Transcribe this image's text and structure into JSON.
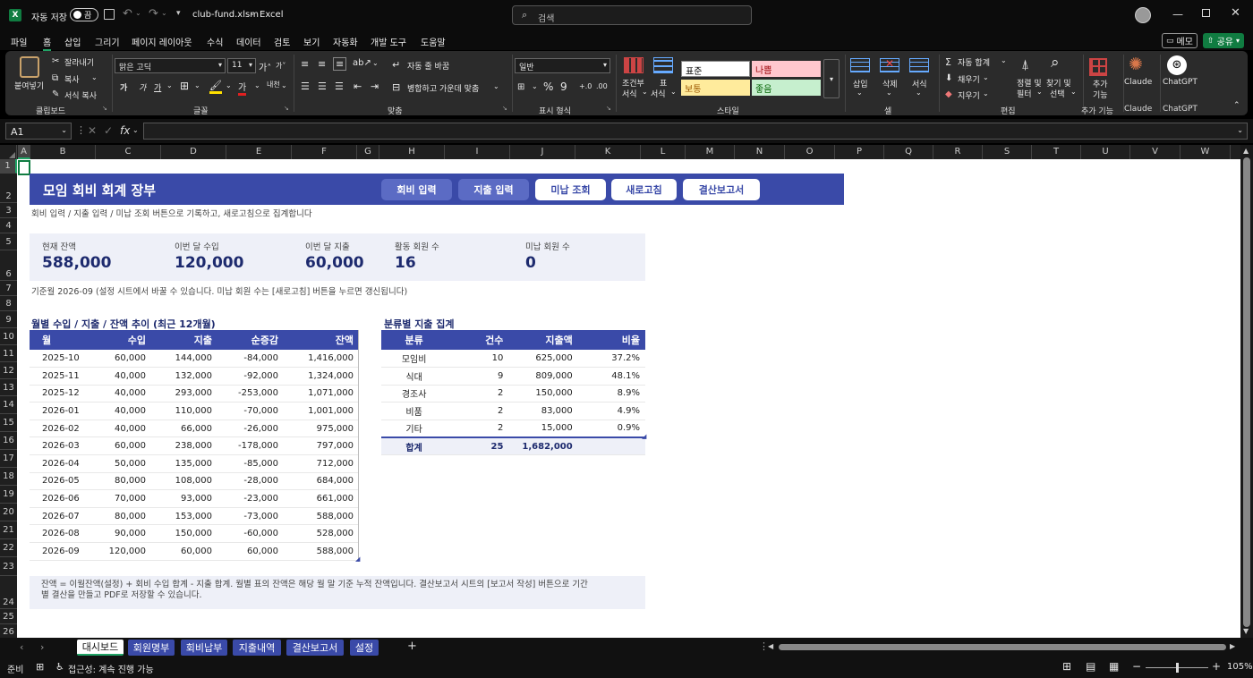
{
  "titlebar": {
    "autosave_label": "자동 저장",
    "autosave_state": "끔",
    "filename": "club-fund.xlsm",
    "app": "Excel",
    "search_placeholder": "검색",
    "separator": "-"
  },
  "menu": [
    "파일",
    "홈",
    "삽입",
    "그리기",
    "페이지 레이아웃",
    "수식",
    "데이터",
    "검토",
    "보기",
    "자동화",
    "개발 도구",
    "도움말"
  ],
  "memo_label": "메모",
  "share_label": "공유",
  "ribbon": {
    "paste": "붙여넣기",
    "cut": "잘라내기",
    "copy": "복사",
    "format_painter": "서식 복사",
    "clipboard": "클립보드",
    "font_name": "맑은 고딕",
    "font_size": "11",
    "font_group": "글꼴",
    "wrap": "자동 줄 바꿈",
    "merge": "병합하고 가운데 맞춤",
    "align_group": "맞춤",
    "number_format": "일반",
    "number_group": "표시 형식",
    "cond_format_1": "조건부",
    "cond_format_2": "서식",
    "table_format_1": "표",
    "table_format_2": "서식",
    "style_normal": "표준",
    "style_bad": "나쁨",
    "style_neutral": "보통",
    "style_good": "좋음",
    "styles_group": "스타일",
    "insert": "삽입",
    "delete": "삭제",
    "format": "서식",
    "cells_group": "셀",
    "autosum": "자동 합계",
    "fill": "채우기",
    "clear": "지우기",
    "sort_1": "정렬 및",
    "sort_2": "필터",
    "find_1": "찾기 및",
    "find_2": "선택",
    "edit_group": "편집",
    "addins_1": "추가",
    "addins_2": "기능",
    "addins_group": "추가 기능",
    "claude": "Claude",
    "chatgpt": "ChatGPT"
  },
  "formula": {
    "cell_ref": "A1",
    "fx": "fx",
    "value": ""
  },
  "columns": [
    "A",
    "B",
    "C",
    "D",
    "E",
    "F",
    "G",
    "H",
    "I",
    "J",
    "K",
    "L",
    "M",
    "N",
    "O",
    "P",
    "Q",
    "R",
    "S",
    "T",
    "U",
    "V",
    "W"
  ],
  "rows": [
    "1",
    "2",
    "3",
    "4",
    "5",
    "6",
    "7",
    "8",
    "9",
    "10",
    "11",
    "12",
    "13",
    "14",
    "15",
    "16",
    "17",
    "18",
    "19",
    "20",
    "21",
    "22",
    "23",
    "24",
    "25",
    "26"
  ],
  "dashboard": {
    "title": "모임 회비 회계 장부",
    "buttons": [
      "회비 입력",
      "지출 입력",
      "미납 조회",
      "새로고침",
      "결산보고서"
    ],
    "subtitle": "회비 입력 / 지출 입력 / 미납 조회 버튼으로 기록하고, 새로고침으로 집계합니다",
    "kpis": [
      {
        "label": "현재 잔액",
        "value": "588,000"
      },
      {
        "label": "이번 달 수입",
        "value": "120,000"
      },
      {
        "label": "이번 달 지출",
        "value": "60,000"
      },
      {
        "label": "활동 회원 수",
        "value": "16"
      },
      {
        "label": "미납 회원 수",
        "value": "0"
      }
    ],
    "base_note": "기준월 2026-09  (설정 시트에서 바꿀 수 있습니다. 미납 회원 수는 [새로고침] 버튼을 누르면 갱신됩니다)",
    "monthly_title": "월별 수입 / 지출 / 잔액 추이 (최근 12개월)",
    "monthly_headers": [
      "월",
      "수입",
      "지출",
      "순증감",
      "잔액"
    ],
    "monthly_rows": [
      [
        "2025-10",
        "60,000",
        "144,000",
        "-84,000",
        "1,416,000"
      ],
      [
        "2025-11",
        "40,000",
        "132,000",
        "-92,000",
        "1,324,000"
      ],
      [
        "2025-12",
        "40,000",
        "293,000",
        "-253,000",
        "1,071,000"
      ],
      [
        "2026-01",
        "40,000",
        "110,000",
        "-70,000",
        "1,001,000"
      ],
      [
        "2026-02",
        "40,000",
        "66,000",
        "-26,000",
        "975,000"
      ],
      [
        "2026-03",
        "60,000",
        "238,000",
        "-178,000",
        "797,000"
      ],
      [
        "2026-04",
        "50,000",
        "135,000",
        "-85,000",
        "712,000"
      ],
      [
        "2026-05",
        "80,000",
        "108,000",
        "-28,000",
        "684,000"
      ],
      [
        "2026-06",
        "70,000",
        "93,000",
        "-23,000",
        "661,000"
      ],
      [
        "2026-07",
        "80,000",
        "153,000",
        "-73,000",
        "588,000"
      ],
      [
        "2026-08",
        "90,000",
        "150,000",
        "-60,000",
        "528,000"
      ],
      [
        "2026-09",
        "120,000",
        "60,000",
        "60,000",
        "588,000"
      ]
    ],
    "category_title": "분류별 지출 집계",
    "category_headers": [
      "분류",
      "건수",
      "지출액",
      "비율"
    ],
    "category_rows": [
      [
        "모임비",
        "10",
        "625,000",
        "37.2%"
      ],
      [
        "식대",
        "9",
        "809,000",
        "48.1%"
      ],
      [
        "경조사",
        "2",
        "150,000",
        "8.9%"
      ],
      [
        "비품",
        "2",
        "83,000",
        "4.9%"
      ],
      [
        "기타",
        "2",
        "15,000",
        "0.9%"
      ]
    ],
    "category_total": [
      "합계",
      "25",
      "1,682,000",
      ""
    ],
    "footer_note_1": "잔액 = 이월잔액(설정) + 회비 수입 합계 - 지출 합계.  월별 표의 잔액은 해당 월 말 기준 누적 잔액입니다. 결산보고서 시트의 [보고서 작성] 버튼으로 기간",
    "footer_note_2": "별 결산을 만들고 PDF로 저장할 수 있습니다."
  },
  "sheet_tabs": [
    "대시보드",
    "회원명부",
    "회비납부",
    "지출내역",
    "결산보고서",
    "설정"
  ],
  "status": {
    "ready": "준비",
    "accessibility": "접근성: 계속 진행 가능",
    "zoom": "105%"
  },
  "colors": {
    "header_blue": "#3a4aa8",
    "kpi_bg": "#eef0f8",
    "negative": "#e02020",
    "accent_green": "#107c41"
  }
}
